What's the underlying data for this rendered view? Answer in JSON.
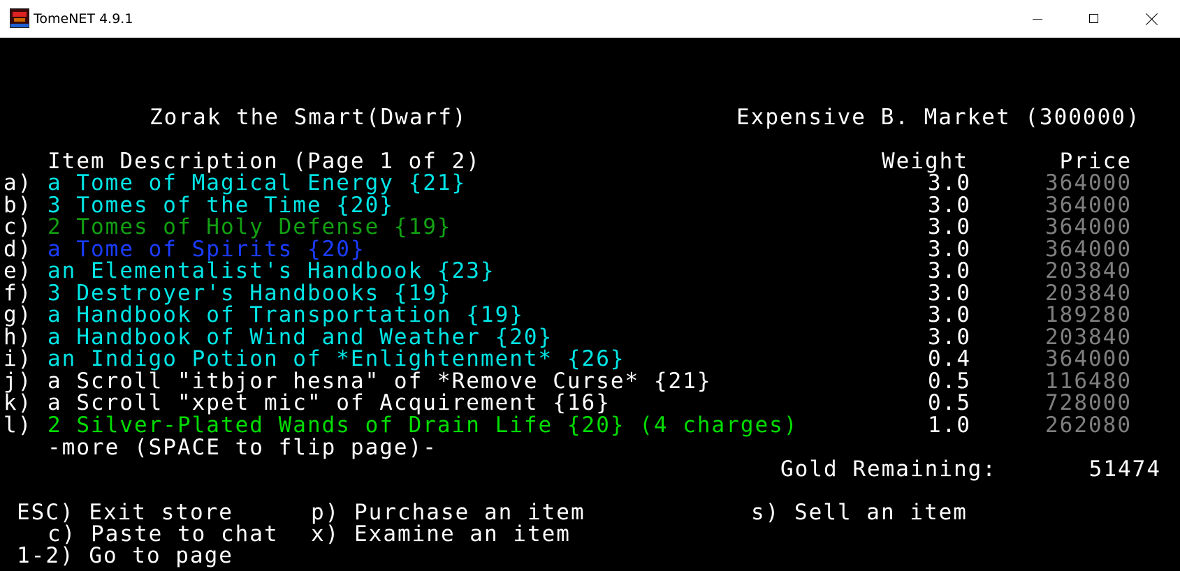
{
  "window": {
    "title": "TomeNET 4.9.1",
    "icon": "tomenet-app-icon",
    "controls": [
      "minimize-icon",
      "maximize-icon",
      "close-icon"
    ]
  },
  "store": {
    "owner": "Zorak the Smart(Dwarf)",
    "name": "Expensive B. Market (300000)",
    "header": {
      "description": "Item Description (Page 1 of 2)",
      "weight": "Weight",
      "price": "Price"
    },
    "items": [
      {
        "key": "a)",
        "name": "a Tome of Magical Energy {21}",
        "weight": "3.0",
        "price": "364000",
        "color": "#00e5e5"
      },
      {
        "key": "b)",
        "name": "3 Tomes of the Time {20}",
        "weight": "3.0",
        "price": "364000",
        "color": "#00e5e5"
      },
      {
        "key": "c)",
        "name": "2 Tomes of Holy Defense {19}",
        "weight": "3.0",
        "price": "364000",
        "color": "#12a012"
      },
      {
        "key": "d)",
        "name": "a Tome of Spirits {20}",
        "weight": "3.0",
        "price": "364000",
        "color": "#1a3cff"
      },
      {
        "key": "e)",
        "name": "an Elementalist's Handbook {23}",
        "weight": "3.0",
        "price": "203840",
        "color": "#00e5e5"
      },
      {
        "key": "f)",
        "name": "3 Destroyer's Handbooks {19}",
        "weight": "3.0",
        "price": "203840",
        "color": "#00e5e5"
      },
      {
        "key": "g)",
        "name": "a Handbook of Transportation {19}",
        "weight": "3.0",
        "price": "189280",
        "color": "#00e5e5"
      },
      {
        "key": "h)",
        "name": "a Handbook of Wind and Weather {20}",
        "weight": "3.0",
        "price": "203840",
        "color": "#00e5e5"
      },
      {
        "key": "i)",
        "name": "an Indigo Potion of *Enlightenment* {26}",
        "weight": "0.4",
        "price": "364000",
        "color": "#00e5e5"
      },
      {
        "key": "j)",
        "name": "a Scroll \"itbjor hesna\" of *Remove Curse* {21}",
        "weight": "0.5",
        "price": "116480",
        "color": "#ffffff"
      },
      {
        "key": "k)",
        "name": "a Scroll \"xpet mic\" of Acquirement {16}",
        "weight": "0.5",
        "price": "728000",
        "color": "#ffffff"
      },
      {
        "key": "l)",
        "name": "2 Silver-Plated Wands of Drain Life {20} (4 charges)",
        "weight": "1.0",
        "price": "262080",
        "color": "#00dd00"
      }
    ],
    "more_prompt": "-more (SPACE to flip page)-",
    "gold_label": "Gold Remaining:",
    "gold_value": "51474"
  },
  "commands": {
    "esc": "ESC) Exit store",
    "purchase": "p) Purchase an item",
    "sell": "s) Sell an item",
    "paste": "c) Paste to chat",
    "examine": "x) Examine an item",
    "goto": "1-2) Go to page"
  },
  "colors": {
    "background": "#000000",
    "default_text": "#ffffff",
    "price_text": "#7f7f7f"
  }
}
